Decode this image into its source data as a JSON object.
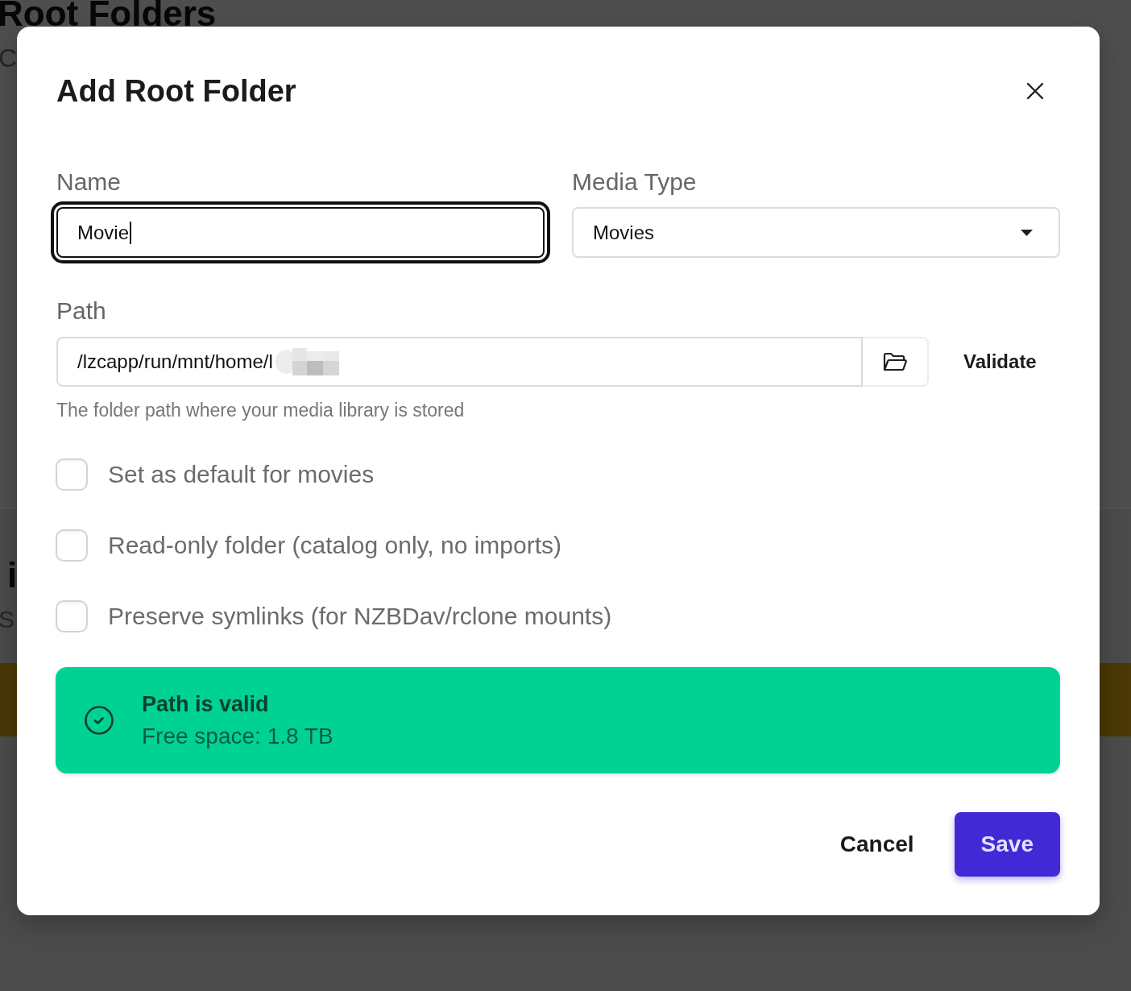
{
  "background_page": {
    "title": "Root Folders",
    "subtitle": "C",
    "section_title": "i",
    "section_subtitle": "S"
  },
  "dialog": {
    "title": "Add Root Folder",
    "name_field": {
      "label": "Name",
      "value": "Movie",
      "focused": true
    },
    "media_type_field": {
      "label": "Media Type",
      "value": "Movies",
      "focused": false
    },
    "path_field": {
      "label": "Path",
      "value": "/lzcapp/run/mnt/home/l",
      "focused": false,
      "hint": "The folder path where your media library is stored",
      "validate_button": "Validate"
    },
    "options": [
      {
        "label": "Set as default for movies",
        "checked": false
      },
      {
        "label": "Read-only folder (catalog only, no imports)",
        "checked": false
      },
      {
        "label": "Preserve symlinks (for NZBDav/rclone mounts)",
        "checked": false
      }
    ],
    "alert": {
      "kind": "success",
      "title": "Path is valid",
      "detail": "Free space: 1.8 TB"
    },
    "buttons": [
      {
        "label": "Cancel",
        "kind": "plain"
      },
      {
        "label": "Save",
        "kind": "primary"
      }
    ]
  }
}
